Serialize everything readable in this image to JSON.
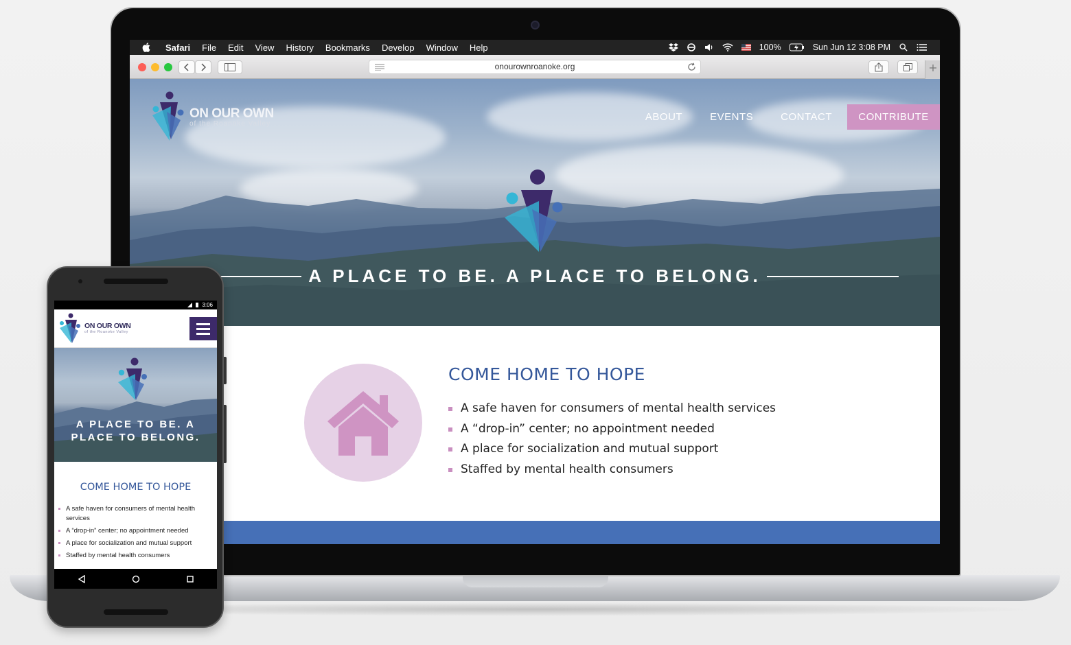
{
  "menubar": {
    "apple_icon": "apple-icon",
    "items": [
      "Safari",
      "File",
      "Edit",
      "View",
      "History",
      "Bookmarks",
      "Develop",
      "Window",
      "Help"
    ],
    "battery": "100%",
    "datetime": "Sun Jun 12  3:08 PM",
    "status_icons": [
      "dropbox-icon",
      "sync-icon",
      "volume-icon",
      "wifi-icon",
      "flag-icon",
      "battery-icon",
      "spotlight-icon",
      "list-icon"
    ]
  },
  "browser": {
    "url": "onourownroanoke.org",
    "traffic_colors": [
      "#fc5f57",
      "#fdbc2e",
      "#28c840"
    ]
  },
  "site": {
    "logo": {
      "title": "ON OUR OWN",
      "subtitle": "of the Roanoke Valley"
    },
    "nav": [
      "ABOUT",
      "EVENTS",
      "CONTACT"
    ],
    "contribute": "CONTRIBUTE",
    "tagline": "A PLACE TO BE. A PLACE TO BELONG.",
    "section_title": "COME HOME TO HOPE",
    "bullets": [
      "A safe haven for consumers of mental health services",
      "A “drop-in” center; no appointment needed",
      "A place for socialization and mutual support",
      "Staffed by mental health consumers"
    ],
    "colors": {
      "accent": "#cf94c3",
      "title": "#34579a",
      "band": "#4670b7",
      "logo_dark": "#3d2a6a",
      "logo_teal": "#35b6d6"
    }
  },
  "phone": {
    "status_time": "3:06",
    "logo": {
      "title": "ON OUR OWN",
      "subtitle": "of the Roanoke Valley"
    },
    "tagline_line1": "A PLACE TO BE. A",
    "tagline_line2": "PLACE TO BELONG.",
    "section_title": "COME HOME TO HOPE",
    "bullets": [
      "A safe haven for consumers of mental health services",
      "A “drop-in” center; no appointment needed",
      "A place for socialization and mutual support",
      "Staffed by mental health consumers"
    ]
  }
}
